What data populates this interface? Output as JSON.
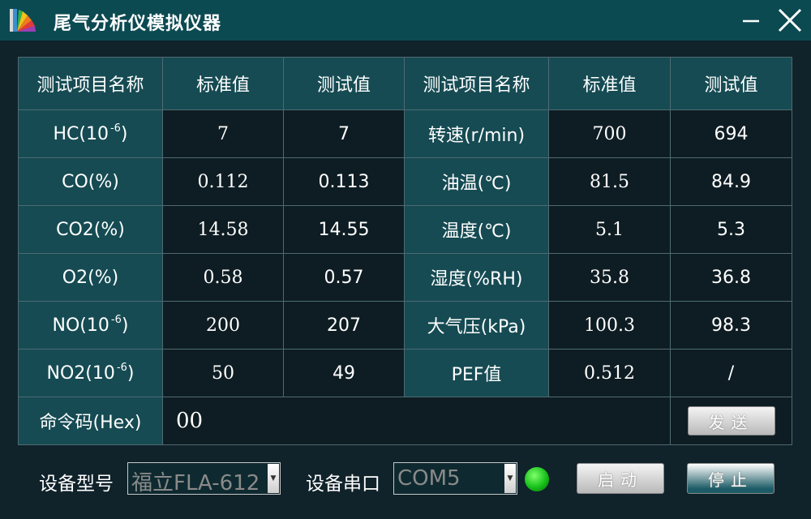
{
  "window": {
    "title": "尾气分析仪模拟仪器",
    "minimize_glyph": "—",
    "close_glyph": "✕"
  },
  "table": {
    "headers": [
      "测试项目名称",
      "标准值",
      "测试值",
      "测试项目名称",
      "标准值",
      "测试值"
    ],
    "rows": [
      {
        "name1": "HC(10",
        "sup1": "-6",
        "suffix1": ")",
        "std1": "7",
        "test1": "7",
        "name2": "转速(r/min)",
        "std2": "700",
        "test2": "694"
      },
      {
        "name1": "CO(%)",
        "std1": "0.112",
        "test1": "0.113",
        "name2": "油温(℃)",
        "std2": "81.5",
        "test2": "84.9"
      },
      {
        "name1": "CO2(%)",
        "std1": "14.58",
        "test1": "14.55",
        "name2": "温度(℃)",
        "std2": "5.1",
        "test2": "5.3"
      },
      {
        "name1": "O2(%)",
        "std1": "0.58",
        "test1": "0.57",
        "name2": "湿度(%RH)",
        "std2": "35.8",
        "test2": "36.8"
      },
      {
        "name1": "NO(10",
        "sup1": "-6",
        "suffix1": ")",
        "std1": "200",
        "test1": "207",
        "name2": "大气压(kPa)",
        "std2": "100.3",
        "test2": "98.3"
      },
      {
        "name1": "NO2(10",
        "sup1": "-6",
        "suffix1": ")",
        "std1": "50",
        "test1": "49",
        "name2": "PEF值",
        "std2": "0.512",
        "test2": "/"
      }
    ],
    "command": {
      "label": "命令码(Hex)",
      "value": "00",
      "send_label": "发送"
    }
  },
  "bottom": {
    "device_model_label": "设备型号",
    "device_model_value": "福立FLA-612",
    "serial_port_label": "设备串口",
    "serial_port_value": "COM5",
    "start_label": "启动",
    "stop_label": "停止",
    "status_color": "#17c01a"
  },
  "colors": {
    "title_bar": "#0c4a52",
    "label_cell": "#164b53",
    "value_cell": "#0e1d23",
    "border": "#4f6a72"
  }
}
